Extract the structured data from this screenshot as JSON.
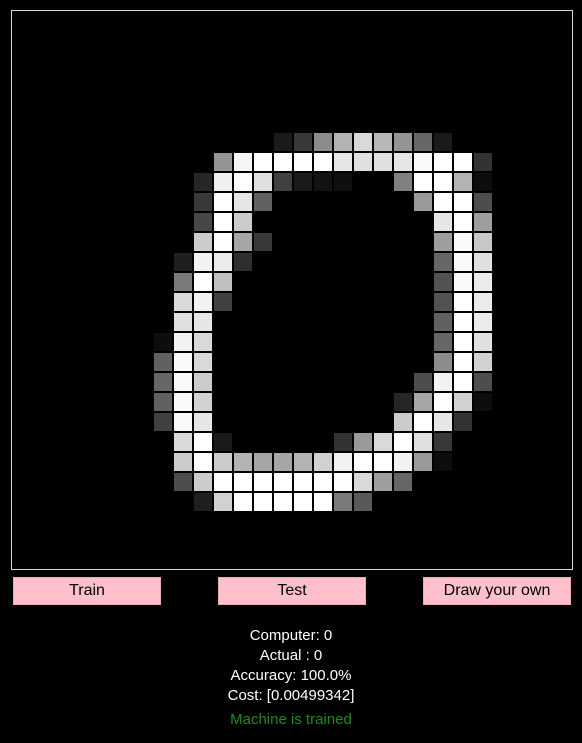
{
  "buttons": {
    "train": "Train",
    "test": "Test",
    "draw": "Draw your own"
  },
  "stats": {
    "computer": "Computer: 0",
    "actual": "Actual : 0",
    "accuracy": "Accuracy: 100.0%",
    "cost": "Cost: [0.00499342]"
  },
  "status": "Machine is trained",
  "digit_pixels": {
    "origin_col": 6,
    "origin_row": 5,
    "values": [
      [
        0,
        0,
        0,
        0,
        0,
        0,
        0,
        0,
        0,
        0,
        0,
        0,
        0,
        0,
        0,
        0,
        0,
        0,
        0,
        0
      ],
      [
        0,
        0,
        0,
        0,
        0,
        0,
        0,
        10,
        22,
        55,
        70,
        85,
        72,
        58,
        40,
        10,
        0,
        0,
        0,
        0
      ],
      [
        0,
        0,
        0,
        0,
        58,
        96,
        100,
        100,
        100,
        100,
        90,
        88,
        88,
        90,
        98,
        100,
        100,
        20,
        0,
        0
      ],
      [
        0,
        0,
        0,
        15,
        94,
        100,
        88,
        25,
        10,
        7,
        6,
        0,
        0,
        50,
        100,
        100,
        70,
        5,
        0,
        0
      ],
      [
        0,
        0,
        0,
        22,
        100,
        90,
        38,
        0,
        0,
        0,
        0,
        0,
        0,
        0,
        60,
        100,
        100,
        30,
        0,
        0
      ],
      [
        0,
        0,
        0,
        28,
        100,
        80,
        0,
        0,
        0,
        0,
        0,
        0,
        0,
        0,
        0,
        90,
        100,
        62,
        0,
        0
      ],
      [
        0,
        0,
        0,
        80,
        100,
        65,
        22,
        0,
        0,
        0,
        0,
        0,
        0,
        0,
        0,
        62,
        98,
        78,
        0,
        0
      ],
      [
        0,
        0,
        12,
        95,
        92,
        18,
        0,
        0,
        0,
        0,
        0,
        0,
        0,
        0,
        0,
        40,
        98,
        88,
        0,
        0
      ],
      [
        0,
        0,
        48,
        100,
        75,
        0,
        0,
        0,
        0,
        0,
        0,
        0,
        0,
        0,
        0,
        32,
        98,
        92,
        0,
        0
      ],
      [
        0,
        0,
        85,
        95,
        25,
        0,
        0,
        0,
        0,
        0,
        0,
        0,
        0,
        0,
        0,
        32,
        100,
        92,
        0,
        0
      ],
      [
        0,
        0,
        88,
        90,
        0,
        0,
        0,
        0,
        0,
        0,
        0,
        0,
        0,
        0,
        0,
        38,
        100,
        92,
        0,
        0
      ],
      [
        0,
        5,
        95,
        85,
        0,
        0,
        0,
        0,
        0,
        0,
        0,
        0,
        0,
        0,
        0,
        40,
        100,
        88,
        0,
        0
      ],
      [
        0,
        38,
        98,
        85,
        0,
        0,
        0,
        0,
        0,
        0,
        0,
        0,
        0,
        0,
        0,
        55,
        100,
        82,
        0,
        0
      ],
      [
        0,
        40,
        98,
        80,
        0,
        0,
        0,
        0,
        0,
        0,
        0,
        0,
        0,
        0,
        30,
        95,
        100,
        30,
        0,
        0
      ],
      [
        0,
        38,
        98,
        82,
        0,
        0,
        0,
        0,
        0,
        0,
        0,
        0,
        0,
        15,
        65,
        100,
        82,
        5,
        0,
        0
      ],
      [
        0,
        25,
        98,
        90,
        0,
        0,
        0,
        0,
        0,
        0,
        0,
        0,
        0,
        80,
        100,
        90,
        20,
        0,
        0,
        0
      ],
      [
        0,
        0,
        85,
        100,
        10,
        0,
        0,
        0,
        0,
        0,
        20,
        60,
        85,
        100,
        88,
        22,
        0,
        0,
        0,
        0
      ],
      [
        0,
        0,
        80,
        100,
        80,
        70,
        65,
        65,
        70,
        82,
        95,
        100,
        100,
        95,
        60,
        5,
        0,
        0,
        0,
        0
      ],
      [
        0,
        0,
        30,
        80,
        100,
        100,
        100,
        100,
        100,
        100,
        100,
        85,
        62,
        40,
        0,
        0,
        0,
        0,
        0,
        0
      ],
      [
        0,
        0,
        0,
        12,
        82,
        100,
        100,
        100,
        100,
        100,
        48,
        35,
        0,
        0,
        0,
        0,
        0,
        0,
        0,
        0
      ]
    ]
  }
}
